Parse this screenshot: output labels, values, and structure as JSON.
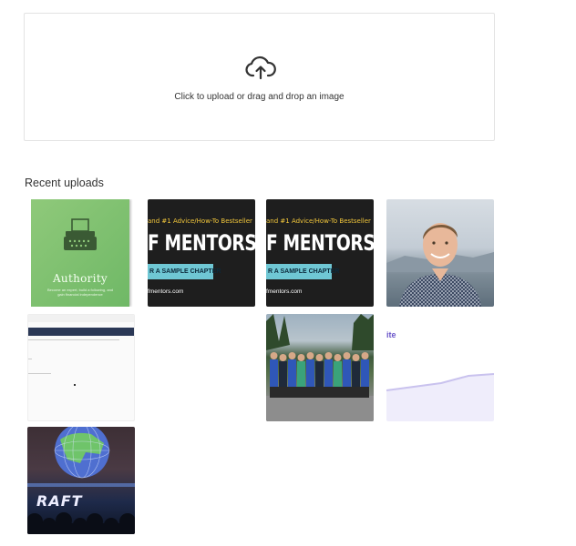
{
  "upload": {
    "hint": "Click to upload or drag and drop an image",
    "icon": "cloud-upload-icon"
  },
  "recent": {
    "heading": "Recent uploads",
    "items": [
      {
        "kind": "book",
        "title": "Authority",
        "blurb": "Become an expert, build a following, and gain financial independence",
        "cover_color": "#7cc06f"
      },
      {
        "kind": "banner",
        "top": "and #1 Advice/How-To Bestseller",
        "big": "F MENTORS",
        "cta": "R A SAMPLE CHAPTER",
        "url": "fmentors.com"
      },
      {
        "kind": "banner",
        "top": "and #1 Advice/How-To Bestseller",
        "big": "F MENTORS",
        "cta": "R A SAMPLE CHAPTER",
        "url": "fmentors.com"
      },
      {
        "kind": "portrait"
      },
      {
        "kind": "screenshot"
      },
      {
        "kind": "group-photo"
      },
      {
        "kind": "chart",
        "label": "ite"
      },
      {
        "kind": "conference",
        "text": "RAFT"
      }
    ]
  }
}
